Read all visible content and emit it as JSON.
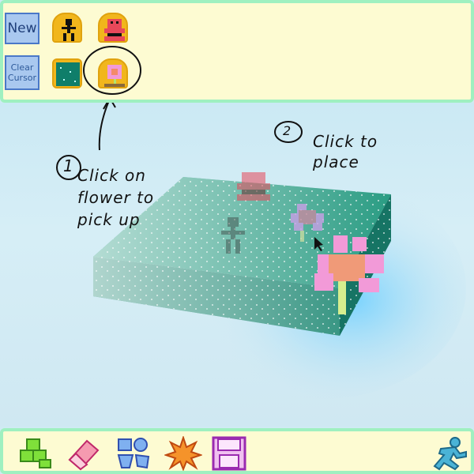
{
  "toolbar_top": {
    "new_label": "New",
    "clear_cursor_label": "Clear\nCursor",
    "palette_icons": [
      "person-icon",
      "pink-creature-icon",
      "green-block-icon",
      "flower-icon"
    ]
  },
  "annotations": {
    "step1_number": "1",
    "step1_text": "Click on flower to pick up",
    "step2_number": "2",
    "step2_text": "Click to place"
  },
  "toolbar_bottom": {
    "tools": [
      "blocks-icon",
      "eraser-icon",
      "shapes-icon",
      "splat-icon",
      "save-icon"
    ],
    "run_icon": "running-person-icon"
  },
  "colors": {
    "panel_bg": "#fdfbd2",
    "panel_border": "#9ff0c0",
    "button_blue": "#a9c8ef",
    "slot_orange": "#f1b61c",
    "block_teal": "#1f8f7a",
    "flower_pink": "#f29ad8"
  }
}
